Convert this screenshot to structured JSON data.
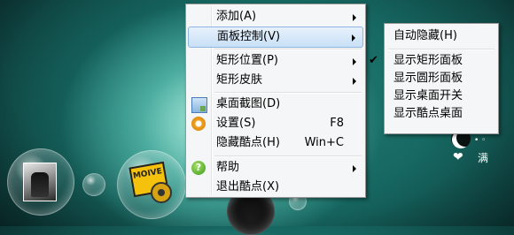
{
  "main_menu": {
    "items": [
      {
        "label": "添加(A)"
      },
      {
        "label": "面板控制(V)"
      },
      {
        "label": "矩形位置(P)"
      },
      {
        "label": "矩形皮肤"
      },
      {
        "label": "桌面截图(D)"
      },
      {
        "label": "设置(S)",
        "shortcut": "F8"
      },
      {
        "label": "隐藏酷点(H)",
        "shortcut": "Win+C"
      },
      {
        "label": "帮助"
      },
      {
        "label": "退出酷点(X)"
      }
    ]
  },
  "sub_menu": {
    "items": [
      {
        "label": "自动隐藏(H)"
      },
      {
        "label": "显示矩形面板",
        "checked": true
      },
      {
        "label": "显示圆形面板"
      },
      {
        "label": "显示桌面开关"
      },
      {
        "label": "显示酷点桌面"
      }
    ]
  },
  "desktop": {
    "movie_icon_text": "MOIVE",
    "widget_label": "满"
  },
  "icons": [
    "capture-icon",
    "gear-icon",
    "help-icon",
    "check-icon",
    "submenu-arrow-icon"
  ],
  "colors": {
    "highlight": "#c9e0f7",
    "menu_bg": "#f5f6f7"
  }
}
